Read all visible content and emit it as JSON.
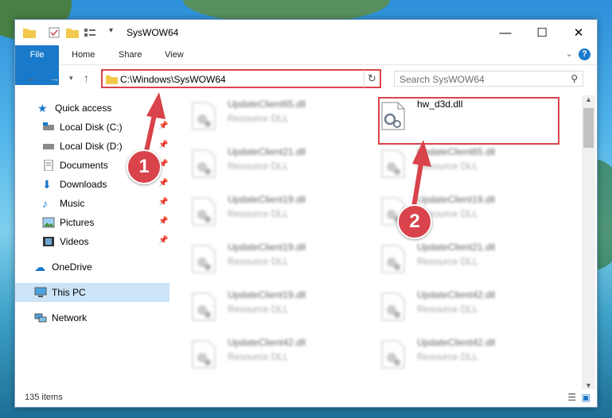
{
  "window": {
    "title": "SysWOW64"
  },
  "ribbon": {
    "tabs": [
      "File",
      "Home",
      "Share",
      "View"
    ]
  },
  "address": {
    "path": "C:\\Windows\\SysWOW64",
    "search_placeholder": "Search SysWOW64"
  },
  "sidebar": {
    "quick_access": "Quick access",
    "items": [
      "Local Disk (C:)",
      "Local Disk (D:)",
      "Documents",
      "Downloads",
      "Music",
      "Pictures",
      "Videos"
    ],
    "onedrive": "OneDrive",
    "this_pc": "This PC",
    "network": "Network"
  },
  "files": {
    "col1": [
      {
        "name": "UpdateClient65.dll",
        "type": "Resource DLL"
      },
      {
        "name": "UpdateClient21.dll",
        "type": "Resource DLL"
      },
      {
        "name": "UpdateClient19.dll",
        "type": "Resource DLL"
      },
      {
        "name": "UpdateClient19.dll",
        "type": "Resource DLL"
      },
      {
        "name": "UpdateClient19.dll",
        "type": "Resource DLL"
      },
      {
        "name": "UpdateClient42.dll",
        "type": "Resource DLL"
      }
    ],
    "col2": [
      {
        "name": "hw_d3d.dll",
        "type": ""
      },
      {
        "name": "UpdateClient65.dll",
        "type": "Resource DLL"
      },
      {
        "name": "UpdateClient19.dll",
        "type": "Resource DLL"
      },
      {
        "name": "UpdateClient21.dll",
        "type": "Resource DLL"
      },
      {
        "name": "UpdateClient42.dll",
        "type": "Resource DLL"
      },
      {
        "name": "UpdateClient42.dll",
        "type": "Resource DLL"
      }
    ]
  },
  "status": {
    "items": "135 items"
  },
  "annotations": [
    "1",
    "2"
  ],
  "colors": {
    "accent": "#1979ca",
    "highlight": "#d9434b",
    "selection": "#cce4f7"
  },
  "icons": {
    "folder": "folder-icon",
    "dll": "dll-gear-icon"
  }
}
